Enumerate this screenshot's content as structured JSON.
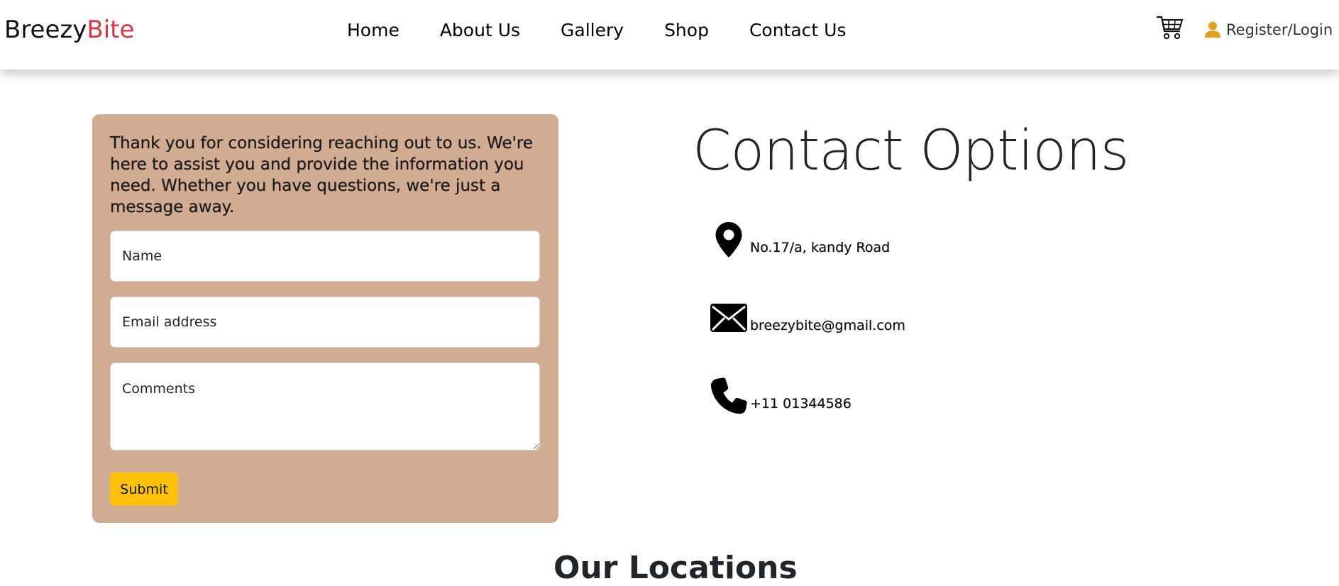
{
  "nav": {
    "brand_part1": "Breezy",
    "brand_part2": "Bite",
    "links": [
      "Home",
      "About Us",
      "Gallery",
      "Shop",
      "Contact Us"
    ],
    "cart_icon": "cart-icon",
    "login_label": "Register/Login",
    "login_icon": "user-icon"
  },
  "form": {
    "intro": "Thank you for considering reaching out to us. We're here to assist you and provide the information you need. Whether you have questions, we're just a message away.",
    "name_placeholder": "Name",
    "email_placeholder": "Email address",
    "comments_placeholder": "Comments",
    "submit_label": "Submit",
    "card_color": "#d2ab93",
    "button_color": "#ffc107"
  },
  "contact": {
    "title": "Contact Options",
    "address": "No.17/a, kandy Road",
    "email": "breezybite@gmail.com",
    "phone": "+11 01344586"
  },
  "locations": {
    "title": "Our Locations"
  },
  "colors": {
    "brand_accent": "#dc3545",
    "user_icon": "#e0a11b"
  }
}
